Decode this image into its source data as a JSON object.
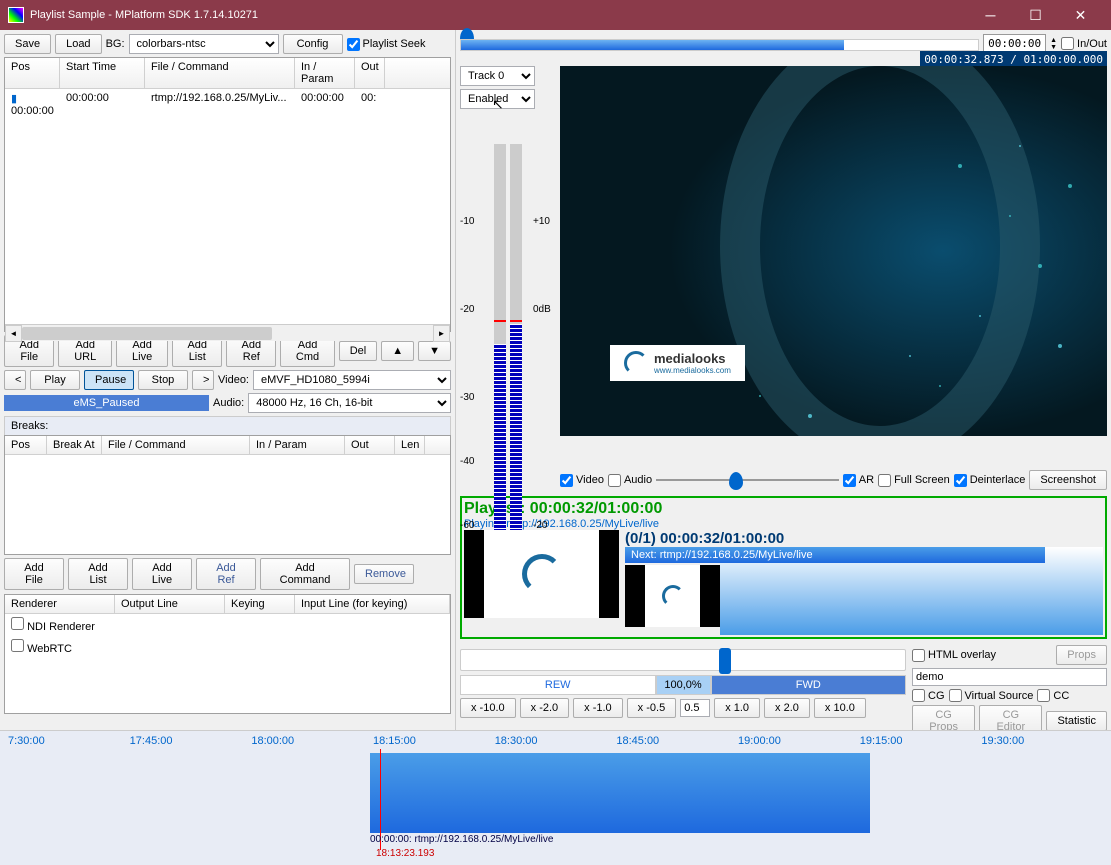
{
  "title": "Playlist Sample - MPlatform SDK 1.7.14.10271",
  "toolbar": {
    "save": "Save",
    "load": "Load",
    "bg_label": "BG:",
    "bg_value": "colorbars-ntsc",
    "config": "Config",
    "playlist_seek": "Playlist Seek"
  },
  "playlist_cols": {
    "pos": "Pos",
    "start": "Start Time",
    "file": "File / Command",
    "inparam": "In / Param",
    "out": "Out"
  },
  "playlist_row": {
    "pos": "00:00:00",
    "start": "00:00:00",
    "file": "rtmp://192.168.0.25/MyLiv...",
    "inparam": "00:00:00",
    "out": "00:"
  },
  "pl_btns": {
    "addfile": "Add File",
    "addurl": "Add URL",
    "addlive": "Add Live",
    "addlist": "Add List",
    "addref": "Add Ref",
    "addcmd": "Add Cmd",
    "del": "Del"
  },
  "transport": {
    "play": "Play",
    "pause": "Pause",
    "stop": "Stop",
    "status": "eMS_Paused",
    "video_lbl": "Video:",
    "video_val": "eMVF_HD1080_5994i",
    "audio_lbl": "Audio:",
    "audio_val": "48000 Hz, 16 Ch, 16-bit"
  },
  "breaks": {
    "label": "Breaks:",
    "cols": {
      "pos": "Pos",
      "breakat": "Break At",
      "file": "File / Command",
      "inparam": "In / Param",
      "out": "Out",
      "len": "Len"
    },
    "btns": {
      "addfile": "Add File",
      "addlist": "Add List",
      "addlive": "Add Live",
      "addref": "Add Ref",
      "addcmd": "Add Command",
      "remove": "Remove"
    }
  },
  "renderer_cols": {
    "renderer": "Renderer",
    "output": "Output Line",
    "keying": "Keying",
    "input": "Input Line (for keying)"
  },
  "renderer_rows": [
    "NDI Renderer",
    "WebRTC"
  ],
  "track_sel": "Track 0",
  "enabled_sel": "Enabled",
  "meter": {
    "l10": "-10",
    "l20": "-20",
    "l30": "-30",
    "l40": "-40",
    "l60": "-60",
    "r10": "+10",
    "r0": "0dB",
    "r20": "-20"
  },
  "watermark": {
    "name": "medialooks",
    "url": "www.medialooks.com"
  },
  "tc_in": "00:00:00",
  "tc_elapsed": "00:00:32.873 / 01:00:00.000",
  "inout": "In/Out",
  "vid_opts": {
    "video": "Video",
    "audio": "Audio",
    "ar": "AR",
    "fullscreen": "Full Screen",
    "deinterlace": "Deinterlace",
    "screenshot": "Screenshot"
  },
  "pli": {
    "title": "Playlist: 00:00:32/01:00:00",
    "playing": "Playing: rtmp://192.168.0.25/MyLive/live",
    "counter": "(0/1) 00:00:32/01:00:00",
    "next": "Next: rtmp://192.168.0.25/MyLive/live"
  },
  "html_overlay": "HTML overlay",
  "props": "Props",
  "demo": "demo",
  "cg": "CG",
  "vsource": "Virtual Source",
  "cc": "CC",
  "cgprops": "CG Props",
  "cgeditor": "CG Editor",
  "statistic": "Statistic",
  "speed": {
    "rew": "REW",
    "pct": "100,0%",
    "fwd": "FWD",
    "btns": [
      "x -10.0",
      "x -2.0",
      "x -1.0",
      "x -0.5",
      "0.5",
      "x 1.0",
      "x 2.0",
      "x 10.0"
    ]
  },
  "bt": {
    "ticks": [
      "7:30:00",
      "17:45:00",
      "18:00:00",
      "18:15:00",
      "18:30:00",
      "18:45:00",
      "19:00:00",
      "19:15:00",
      "19:30:00"
    ],
    "clip": "00:00:00: rtmp://192.168.0.25/MyLive/live",
    "now": "18:13:23.193"
  }
}
